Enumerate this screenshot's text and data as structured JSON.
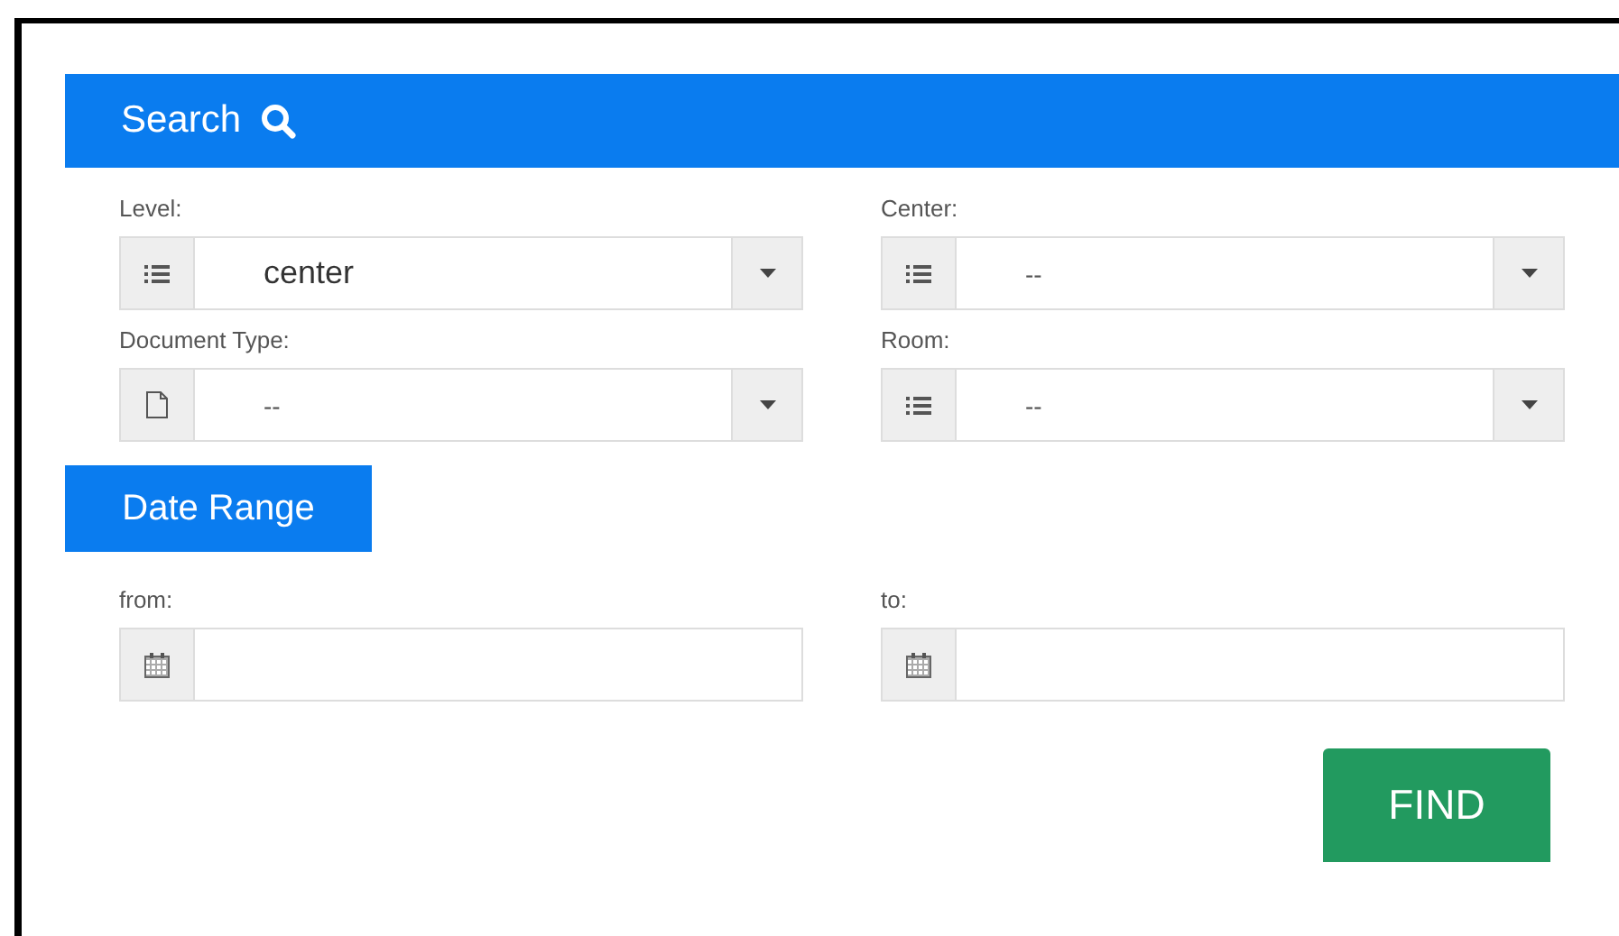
{
  "header": {
    "title": "Search"
  },
  "fields": [
    {
      "label": "Level:",
      "kind": "list",
      "value": "center"
    },
    {
      "label": "Center:",
      "kind": "list",
      "value": "--"
    },
    {
      "label": "Document Type:",
      "kind": "document",
      "value": "--"
    },
    {
      "label": "Room:",
      "kind": "list",
      "value": "--"
    }
  ],
  "date_range": {
    "title": "Date Range",
    "fields": [
      {
        "label": "from:",
        "kind": "date"
      },
      {
        "label": "to:",
        "kind": "date"
      }
    ]
  },
  "buttons": [
    "FIND"
  ]
}
